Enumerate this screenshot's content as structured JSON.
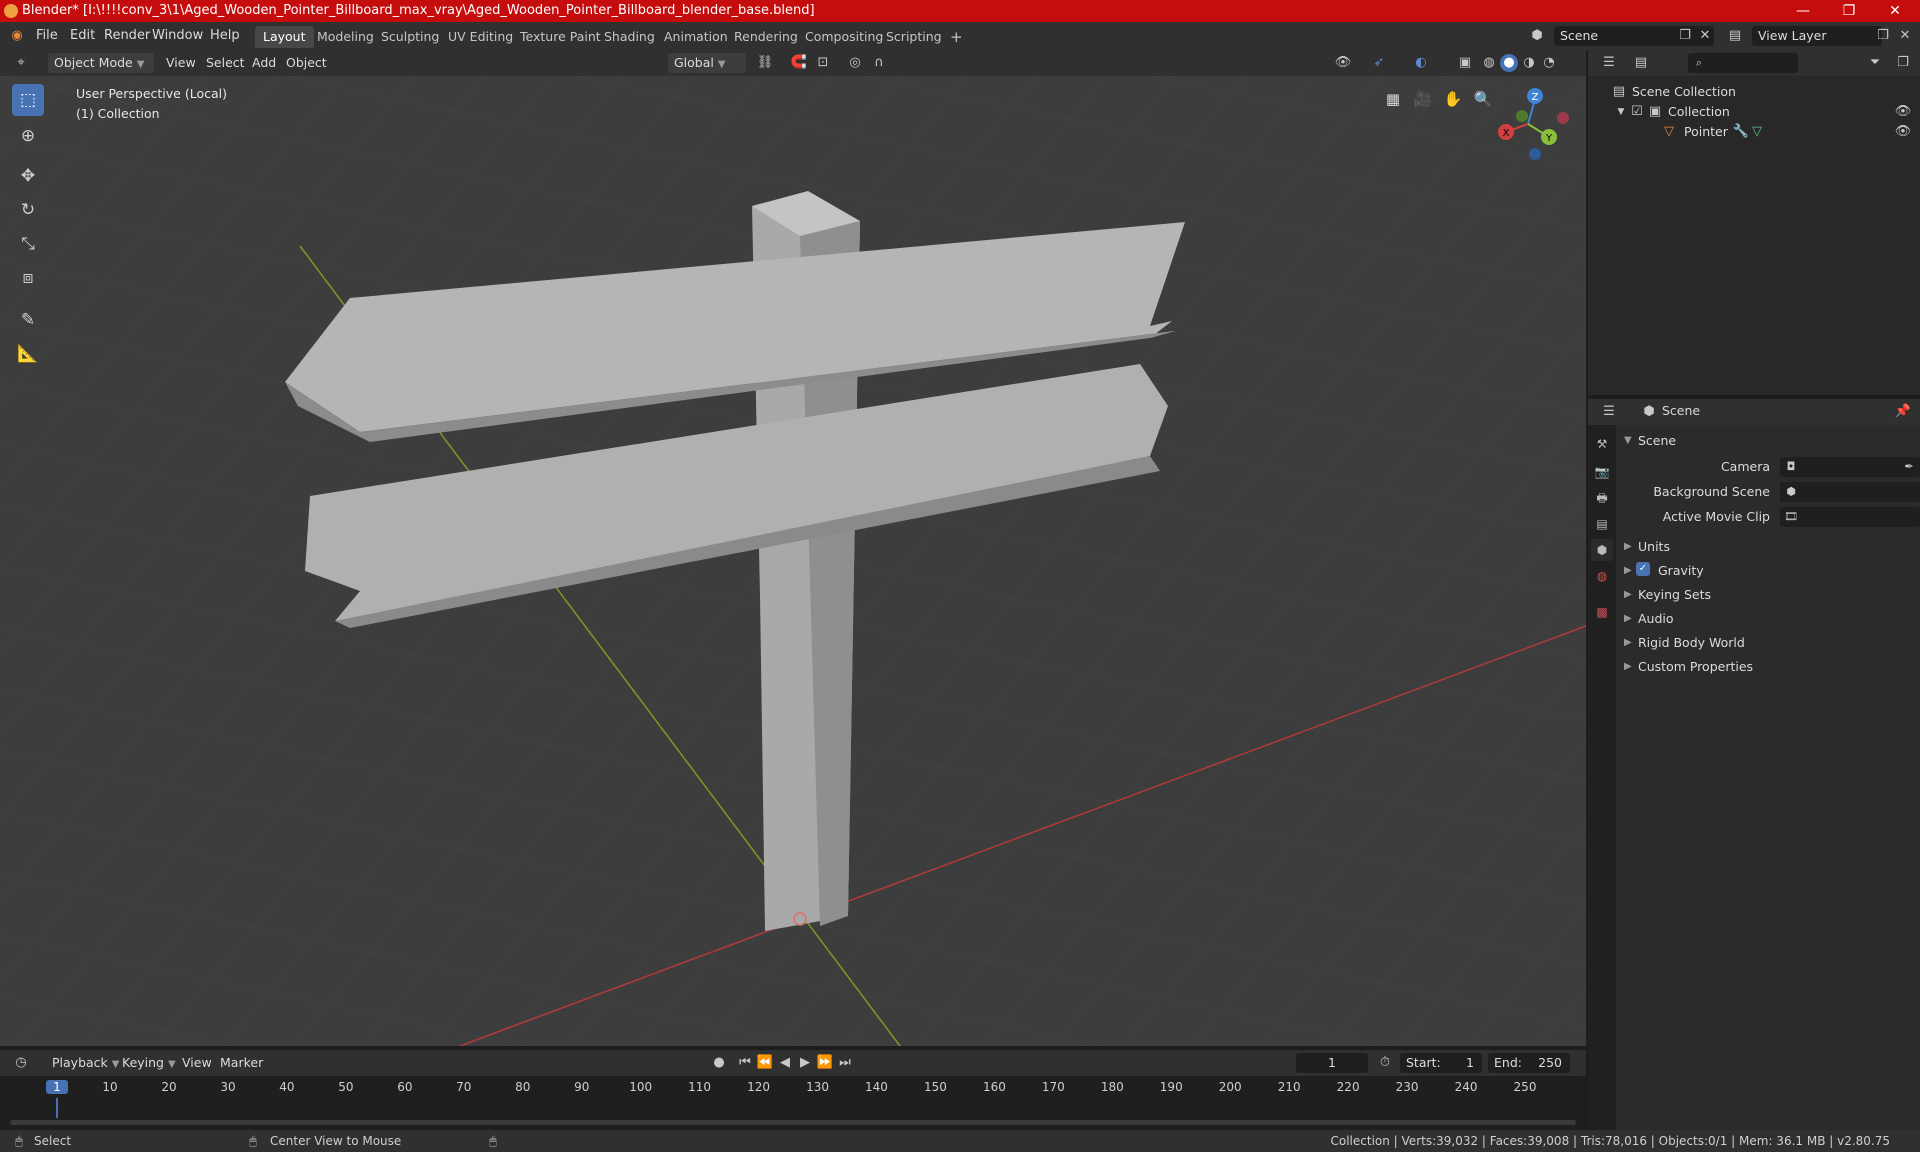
{
  "titlebar": {
    "title": "Blender* [I:\\!!!!conv_3\\1\\Aged_Wooden_Pointer_Billboard_max_vray\\Aged_Wooden_Pointer_Billboard_blender_base.blend]",
    "minimize": "—",
    "maximize": "❐",
    "close": "✕"
  },
  "menu": {
    "file": "File",
    "edit": "Edit",
    "render": "Render",
    "window": "Window",
    "help": "Help"
  },
  "workspaces": [
    {
      "label": "Layout"
    },
    {
      "label": "Modeling"
    },
    {
      "label": "Sculpting"
    },
    {
      "label": "UV Editing"
    },
    {
      "label": "Texture Paint"
    },
    {
      "label": "Shading"
    },
    {
      "label": "Animation"
    },
    {
      "label": "Rendering"
    },
    {
      "label": "Compositing"
    },
    {
      "label": "Scripting"
    }
  ],
  "add_workspace": "+",
  "scene_selector": {
    "value": "Scene"
  },
  "view_layer_selector": {
    "value": "View Layer"
  },
  "viewport_header": {
    "mode": "Object Mode",
    "view": "View",
    "select": "Select",
    "add": "Add",
    "object": "Object",
    "orientation": "Global"
  },
  "viewport": {
    "perspective": "User Perspective (Local)",
    "collection": "(1) Collection",
    "gizmo": {
      "x": "X",
      "y": "Y",
      "z": "Z"
    }
  },
  "outliner": {
    "search_placeholder": "",
    "items": [
      {
        "label": "Scene Collection"
      },
      {
        "label": "Collection"
      },
      {
        "label": "Pointer"
      }
    ]
  },
  "properties": {
    "context": "Scene",
    "panel_title": "Scene",
    "rows": {
      "camera": "Camera",
      "background_scene": "Background Scene",
      "active_movie_clip": "Active Movie Clip"
    },
    "sections": [
      {
        "label": "Units"
      },
      {
        "label": "Gravity"
      },
      {
        "label": "Keying Sets"
      },
      {
        "label": "Audio"
      },
      {
        "label": "Rigid Body World"
      },
      {
        "label": "Custom Properties"
      }
    ]
  },
  "timeline": {
    "playback": "Playback",
    "keying": "Keying",
    "view": "View",
    "marker": "Marker",
    "current_frame": "1",
    "start_label": "Start:",
    "start": "1",
    "end_label": "End:",
    "end": "250",
    "ticks": [
      "1",
      "10",
      "20",
      "30",
      "40",
      "50",
      "60",
      "70",
      "80",
      "90",
      "100",
      "110",
      "120",
      "130",
      "140",
      "150",
      "160",
      "170",
      "180",
      "190",
      "200",
      "210",
      "220",
      "230",
      "240",
      "250"
    ]
  },
  "statusbar": {
    "select": "Select",
    "center_view": "Center View to Mouse",
    "stats": "Collection | Verts:39,032 | Faces:39,008 | Tris:78,016 | Objects:0/1 | Mem: 36.1 MB | v2.80.75"
  },
  "colors": {
    "titlebar": "#c50d0d",
    "accent": "#4772b3",
    "x_axis": "#d13f3f",
    "y_axis": "#8bbf3b",
    "z_axis": "#3e83d6"
  }
}
